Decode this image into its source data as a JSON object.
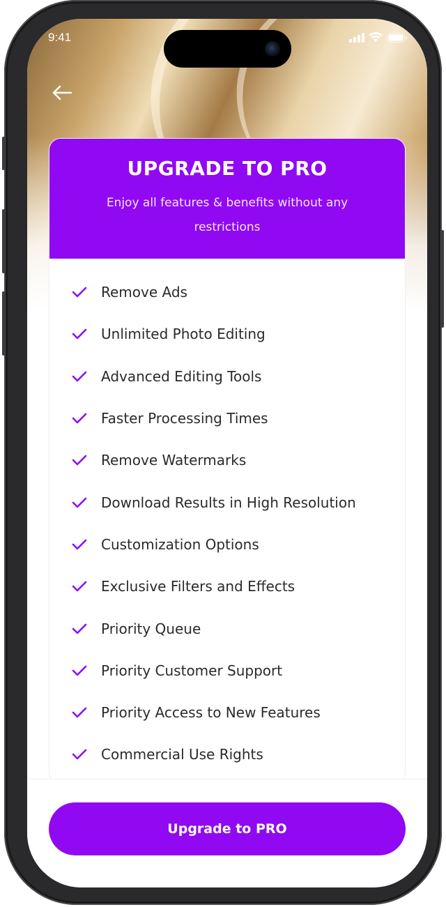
{
  "status_bar": {
    "time": "9:41"
  },
  "header": {
    "back_icon": "arrow-left-icon"
  },
  "promo": {
    "title": "UPGRADE TO PRO",
    "subtitle": "Enjoy all features & benefits without any restrictions"
  },
  "features": [
    {
      "label": "Remove Ads"
    },
    {
      "label": "Unlimited Photo Editing"
    },
    {
      "label": "Advanced Editing Tools"
    },
    {
      "label": "Faster Processing Times"
    },
    {
      "label": "Remove Watermarks"
    },
    {
      "label": "Download Results in High Resolution"
    },
    {
      "label": "Customization Options"
    },
    {
      "label": "Exclusive Filters and Effects"
    },
    {
      "label": "Priority Queue"
    },
    {
      "label": "Priority Customer Support"
    },
    {
      "label": "Priority Access to New Features"
    },
    {
      "label": "Commercial Use Rights"
    }
  ],
  "cta": {
    "label": "Upgrade to PRO"
  },
  "colors": {
    "accent": "#9109f2",
    "text": "#2a2a2e"
  }
}
